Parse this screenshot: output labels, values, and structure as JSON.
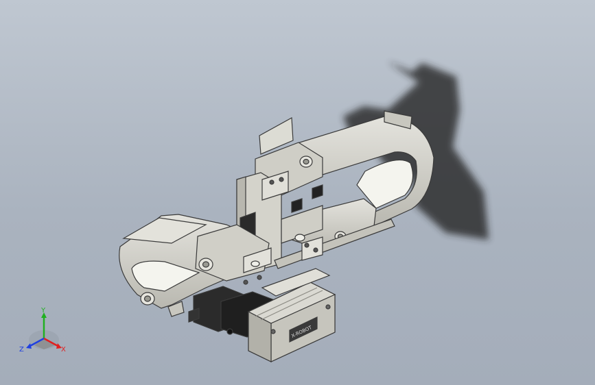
{
  "scene": {
    "description_hidden": "",
    "background_top": "#bfc7d1",
    "background_bottom": "#a4adba",
    "part_color": "#d2d1c9",
    "motor_label": "X-ROBOT"
  },
  "triad": {
    "x_label": "X",
    "y_label": "Y",
    "z_label": "Z",
    "x_color": "#e02020",
    "y_color": "#20b020",
    "z_color": "#2040e0"
  }
}
